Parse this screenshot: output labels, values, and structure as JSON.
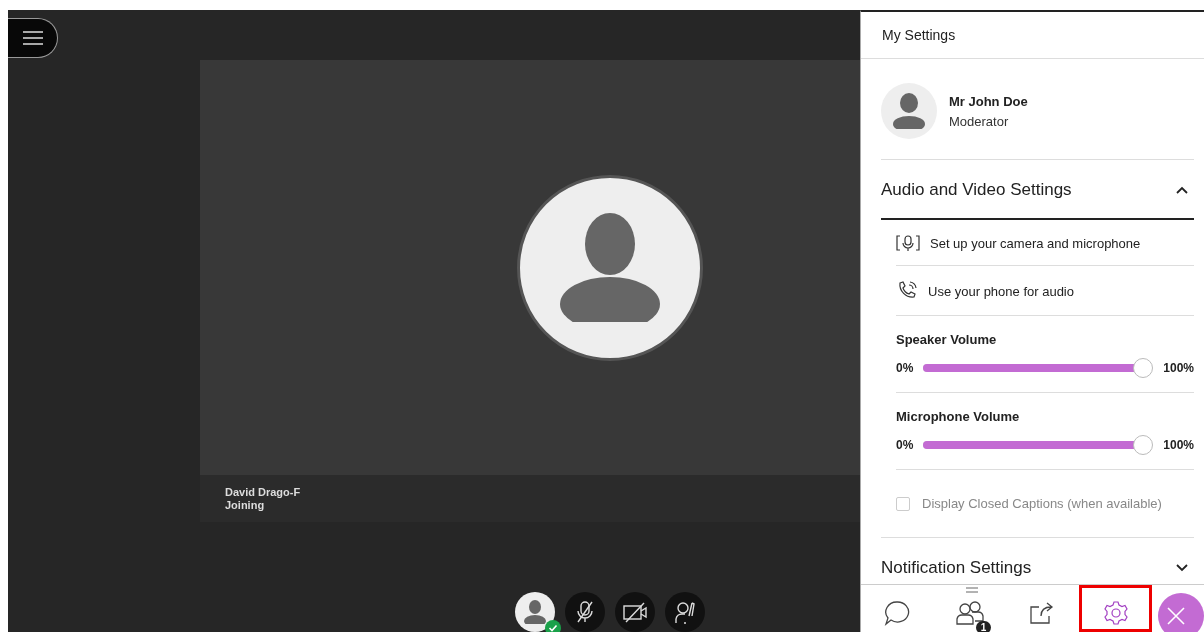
{
  "video_tile": {
    "name": "David Drago-F",
    "status": "Joining"
  },
  "my_controls": [
    {
      "kind": "avatar",
      "connected": true
    },
    {
      "kind": "microphone",
      "off": true
    },
    {
      "kind": "camera",
      "off": true
    },
    {
      "kind": "hand"
    }
  ],
  "panel": {
    "title": "My Settings",
    "user": {
      "name": "Mr John Doe",
      "role": "Moderator"
    },
    "sections": [
      {
        "title": "Audio and Video Settings",
        "expanded": true,
        "items": [
          {
            "kind": "camera-setup",
            "label": "Set up your camera and microphone"
          },
          {
            "kind": "phone",
            "label": "Use your phone for audio"
          },
          {
            "kind": "slider",
            "label": "Speaker Volume",
            "min_label": "0%",
            "max_label": "100%",
            "level": 1
          },
          {
            "kind": "slider",
            "label": "Microphone Volume",
            "min_label": "0%",
            "max_label": "100%",
            "level": 1
          },
          {
            "kind": "checkbox",
            "label": "Display Closed Captions (when available)",
            "checked": false,
            "disabled": true
          }
        ]
      },
      {
        "title": "Notification Settings",
        "expanded": false
      }
    ],
    "tabs": [
      {
        "kind": "chat",
        "selected": false
      },
      {
        "kind": "attendees",
        "badge": "1",
        "selected": false
      },
      {
        "kind": "share",
        "selected": false
      },
      {
        "kind": "settings",
        "selected": true
      }
    ]
  }
}
